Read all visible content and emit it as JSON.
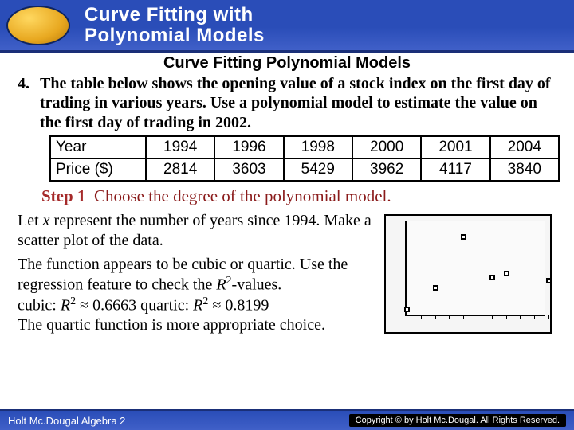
{
  "header": {
    "title_line1": "Curve Fitting with",
    "title_line2": "Polynomial Models"
  },
  "subheading": "Curve Fitting Polynomial Models",
  "problem": {
    "number": "4.",
    "text": "The table below shows the opening value of a stock index on the first day of trading in various years. Use a polynomial model to estimate the value on the first day of trading in 2002."
  },
  "table": {
    "row_labels": [
      "Year",
      "Price ($)"
    ],
    "cols": [
      {
        "year": "1994",
        "price": "2814"
      },
      {
        "year": "1996",
        "price": "3603"
      },
      {
        "year": "1998",
        "price": "5429"
      },
      {
        "year": "2000",
        "price": "3962"
      },
      {
        "year": "2001",
        "price": "4117"
      },
      {
        "year": "2004",
        "price": "3840"
      }
    ]
  },
  "step": {
    "label": "Step 1",
    "text": "Choose the degree of the polynomial model."
  },
  "para1_a": "Let ",
  "para1_var": "x",
  "para1_b": " represent the number of years since 1994. Make a scatter plot of the data.",
  "para2_a": "The function appears to be cubic or quartic. Use the regression feature to check the ",
  "para2_r2": "R",
  "para2_b": "-values.",
  "para3_a": "cubic: ",
  "para3_b": " ≈ 0.6663 quartic: ",
  "para3_c": " ≈ 0.8199",
  "para4": "The quartic function is more appropriate choice.",
  "footer": {
    "left": "Holt Mc.Dougal Algebra 2",
    "right_prefix": "Copyright © by Holt Mc.Dougal.",
    "right_suffix": "All Rights Reserved."
  },
  "chart_data": {
    "type": "scatter",
    "title": "",
    "xlabel": "",
    "ylabel": "",
    "xlim": [
      0,
      10
    ],
    "ylim": [
      2500,
      6000
    ],
    "x": [
      0,
      2,
      4,
      6,
      7,
      10
    ],
    "y": [
      2814,
      3603,
      5429,
      3962,
      4117,
      3840
    ]
  }
}
